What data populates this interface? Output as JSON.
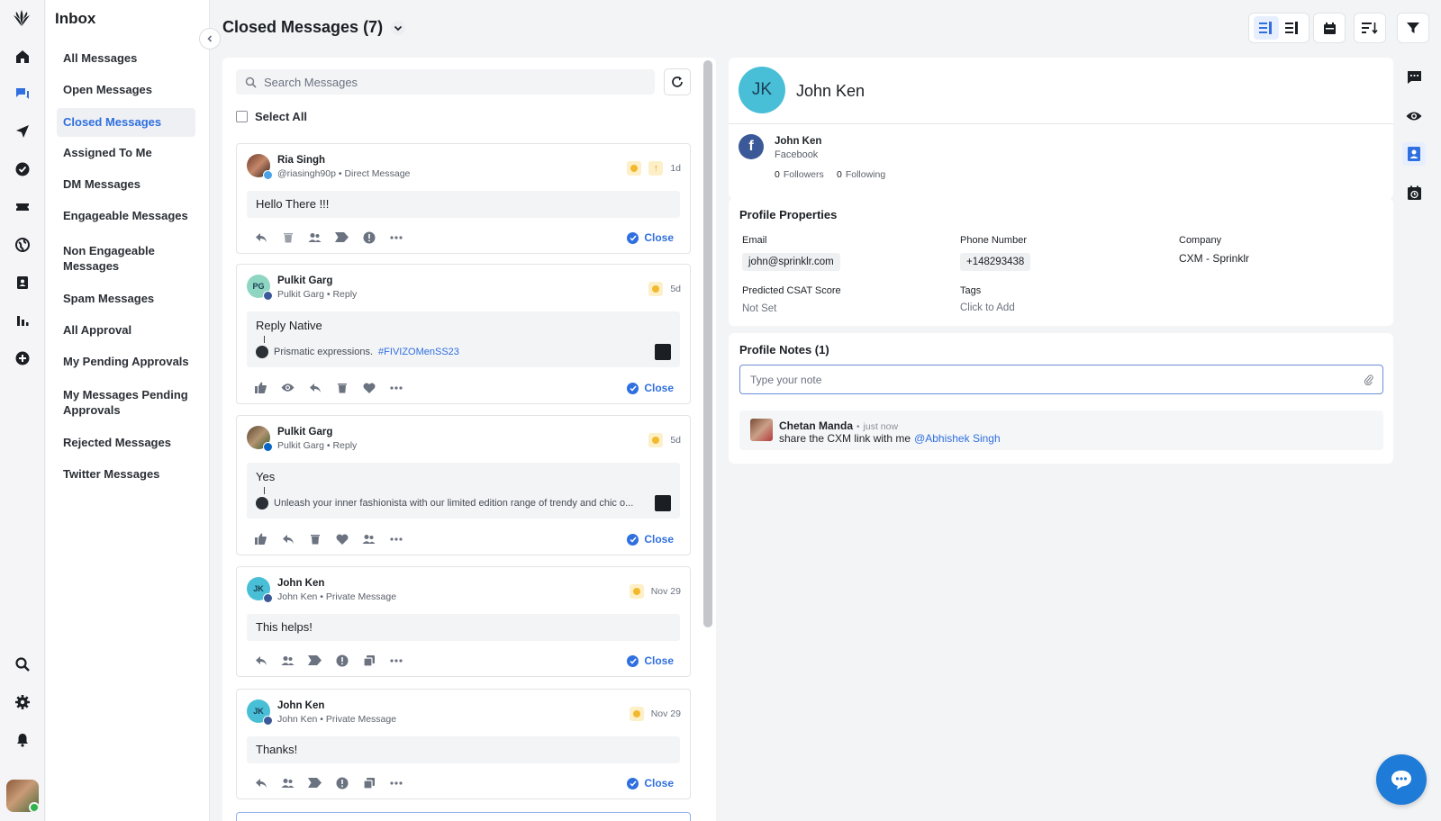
{
  "nav": {
    "title": "Inbox",
    "items": [
      {
        "label": "All Messages"
      },
      {
        "label": "Open Messages"
      },
      {
        "label": "Closed Messages",
        "active": true
      },
      {
        "label": "Assigned To Me"
      },
      {
        "label": "DM Messages"
      },
      {
        "label": "Engageable Messages"
      },
      {
        "label": "Non Engageable Messages"
      },
      {
        "label": "Spam Messages"
      },
      {
        "label": "All Approval"
      },
      {
        "label": "My Pending Approvals"
      },
      {
        "label": "My Messages Pending Approvals"
      },
      {
        "label": "Rejected Messages"
      },
      {
        "label": "Twitter Messages"
      }
    ]
  },
  "main": {
    "title": "Closed Messages (7)",
    "search_placeholder": "Search Messages",
    "select_all": "Select All",
    "close_label": "Close"
  },
  "messages": [
    {
      "name": "Ria Singh",
      "sub": "@riasingh90p • Direct Message",
      "time": "1d",
      "text": "Hello There !!!",
      "network": "twitter"
    },
    {
      "name": "Pulkit Garg",
      "initials": "PG",
      "sub": "Pulkit Garg • Reply",
      "time": "5d",
      "text": "Reply Native",
      "quote": "Prismatic expressions.",
      "quote_tag": "#FIVIZOMenSS23",
      "network": "facebook"
    },
    {
      "name": "Pulkit Garg",
      "sub": "Pulkit Garg • Reply",
      "time": "5d",
      "text": "Yes",
      "quote": "Unleash your inner fashionista with our limited edition range of trendy and chic o...",
      "network": "linkedin"
    },
    {
      "name": "John Ken",
      "initials": "JK",
      "sub": "John Ken • Private Message",
      "time": "Nov 29",
      "text": "This helps!",
      "network": "facebook"
    },
    {
      "name": "John Ken",
      "initials": "JK",
      "sub": "John Ken • Private Message",
      "time": "Nov 29",
      "text": "Thanks!",
      "network": "facebook"
    }
  ],
  "profile": {
    "initials": "JK",
    "name": "John Ken",
    "account_name": "John Ken",
    "account_network": "Facebook",
    "followers_count": "0",
    "followers_label": "Followers",
    "following_count": "0",
    "following_label": "Following"
  },
  "properties": {
    "title": "Profile Properties",
    "email_label": "Email",
    "email": "john@sprinklr.com",
    "phone_label": "Phone Number",
    "phone": "+148293438",
    "company_label": "Company",
    "company": "CXM - Sprinklr",
    "csat_label": "Predicted CSAT Score",
    "csat": "Not Set",
    "tags_label": "Tags",
    "tags": "Click to Add"
  },
  "notes": {
    "title": "Profile Notes (1)",
    "placeholder": "Type your note",
    "author": "Chetan Manda",
    "time": "just now",
    "text": "share the CXM link with me",
    "mention": "@Abhishek Singh"
  },
  "colors": {
    "accent": "#2f6fdf",
    "fab": "#1f7bd8",
    "avatar": "#48bfd7"
  }
}
